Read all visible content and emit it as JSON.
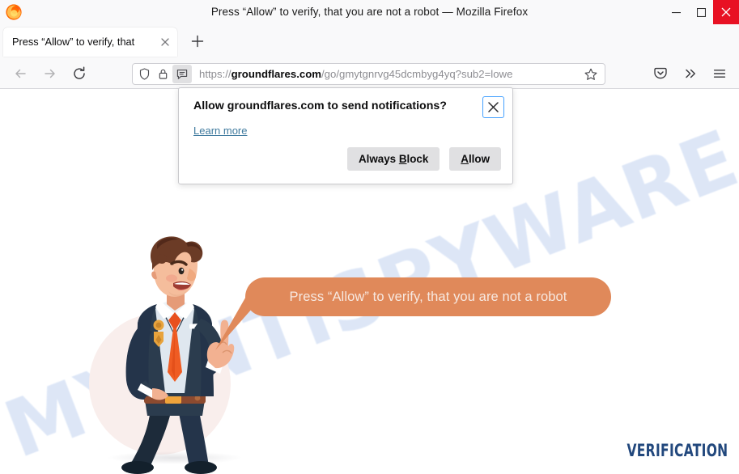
{
  "window": {
    "title": "Press “Allow” to verify, that you are not a robot — Mozilla Firefox",
    "minimize_label": "Minimize",
    "maximize_label": "Maximize",
    "close_label": "Close",
    "app_icon": "firefox-logo-icon"
  },
  "tabs": {
    "items": [
      {
        "label": "Press “Allow” to verify, that",
        "close_label": "Close tab"
      }
    ],
    "new_tab_label": "Open a new tab"
  },
  "toolbar": {
    "back_label": "Go back one page",
    "forward_label": "Go forward one page",
    "reload_label": "Reload current page",
    "pocket_label": "Save to Pocket",
    "overflow_label": "More tools",
    "menu_label": "Open application menu",
    "bookmark_label": "Bookmark this page"
  },
  "urlbar": {
    "scheme": "https://",
    "host": "groundflares.com",
    "path": "/go/gmytgnrvg45dcmbyg4yq?sub2=lowe",
    "shield_icon": "shield-icon",
    "lock_icon": "lock-icon",
    "notification_icon": "notification-permission-icon",
    "star_icon": "star-icon"
  },
  "permission_panel": {
    "title": "Allow groundflares.com to send notifications?",
    "learn_more": "Learn more",
    "close_icon": "close-icon",
    "buttons": {
      "always_block": {
        "pre": "Always ",
        "accesskey": "B",
        "post": "lock"
      },
      "allow": {
        "pre": "",
        "accesskey": "A",
        "post": "llow"
      }
    }
  },
  "page": {
    "bubble_text": "Press “Allow” to verify, that you are not a robot",
    "watermark": "MYANTISPYWARE.COM",
    "verification_wordmark": "VERIFICATION",
    "character_alt": "security-guard-character"
  },
  "colors": {
    "bubble_orange": "#e0895a",
    "bubble_text": "#f7e8e0",
    "watermark_blue": "#c9d8f2",
    "verification_navy": "#22487d",
    "close_button_red": "#e81123",
    "focus_ring_blue": "#45a1ff",
    "suit_navy": "#2b3c4e",
    "tie_orange": "#ef5c23",
    "circle_pink": "#f9eeec"
  }
}
